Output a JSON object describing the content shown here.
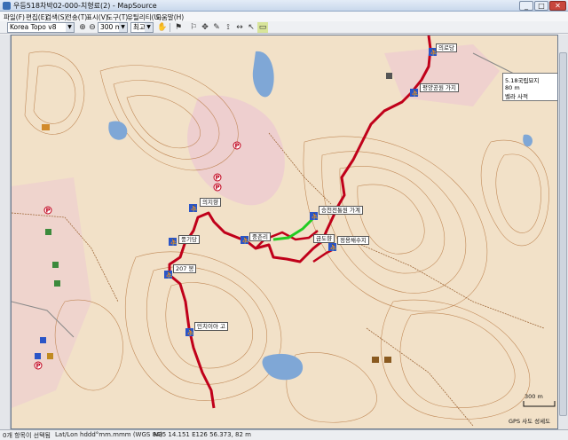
{
  "window": {
    "title": "우등518차박02-000-치형료(2) - MapSource",
    "min_label": "_",
    "max_label": "□",
    "close_label": "✕"
  },
  "menu": [
    "파일(F)",
    "편집(E)",
    "검색(S)",
    "전송(T)",
    "표시(V)",
    "도구(T)",
    "유틸리티(U)",
    "도움말(H)"
  ],
  "toolbar": {
    "product": "Korea Topo v8",
    "zoom": "300 m",
    "detail": "최고",
    "zoom_in_icon": "zoom-in-icon",
    "zoom_out_icon": "zoom-out-icon"
  },
  "map": {
    "labels": {
      "park_center": "5.18국립묘지",
      "distance_80": "80 m",
      "spot_top": "벨라 사적",
      "lbl1": "의로당",
      "lbl2": "평양공원 가지",
      "lbl3": "의지향",
      "lbl4": "풍기당",
      "lbl5": "중촌리",
      "lbl6": "금도향",
      "lbl7": "승천전통원 가계",
      "lbl8": "207 봉",
      "lbl9": "민치이아 고",
      "lbl10": "정용채수지"
    },
    "scale_label": "300 m",
    "gps_note": "GPS 사도 성세도"
  },
  "status": {
    "selection": "0개 항목이 선택됨",
    "format": "Lat/Lon hddd°mm.mmm (WGS 84)",
    "coords": "N35 14.151 E126 56.373, 82 m"
  },
  "colors": {
    "route": "#c0001a",
    "route_green": "#22cc22",
    "terrain": "#f2e1c8",
    "contour": "#b87a44",
    "water": "#7fa7d6"
  }
}
